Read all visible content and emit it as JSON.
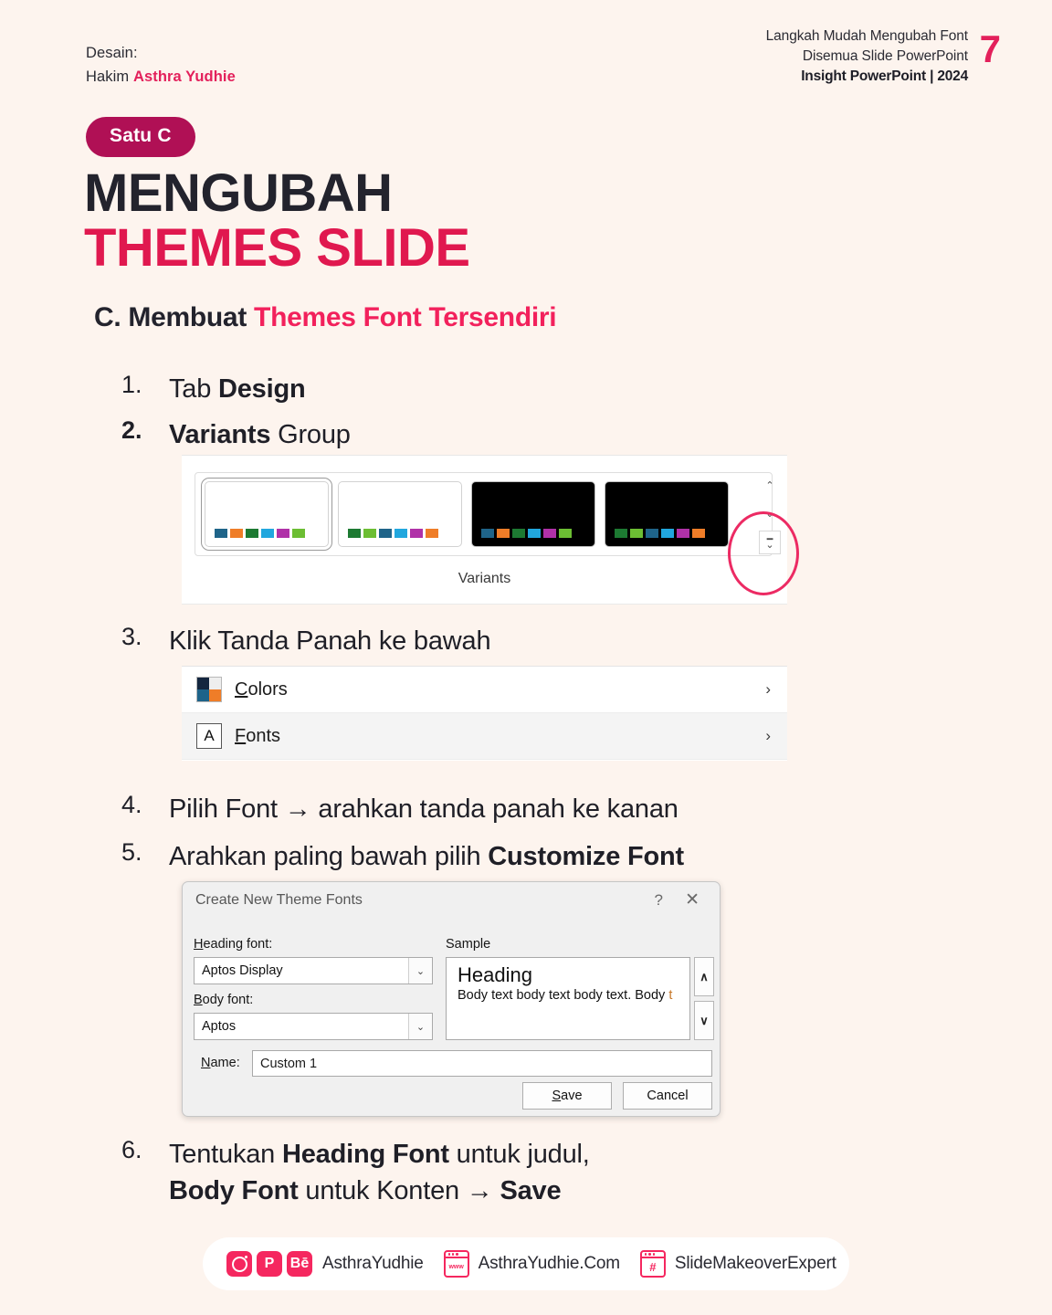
{
  "header": {
    "left_line1": "Desain:",
    "left_line2_plain": "Hakim ",
    "left_line2_bold": "Asthra Yudhie",
    "right_line1": "Langkah Mudah Mengubah Font",
    "right_line2": "Disemua Slide PowerPoint",
    "right_line3": "Insight PowerPoint | 2024",
    "page_number": "7"
  },
  "badge": "Satu C",
  "title": {
    "line1": "MENGUBAH",
    "line2": "THEMES SLIDE"
  },
  "section": {
    "prefix": "C. Membuat ",
    "highlight": "Themes Font Tersendiri"
  },
  "steps": [
    {
      "num": "1.",
      "html": "Tab <b>Design</b>"
    },
    {
      "num": "2.",
      "html": "<b>Variants</b> Group"
    },
    {
      "num": "3.",
      "html": "Klik Tanda Panah ke bawah"
    },
    {
      "num": "4.",
      "html": "Pilih Font → arahkan tanda panah ke kanan"
    },
    {
      "num": "5.",
      "html": "Arahkan paling bawah pilih <b>Customize Font</b>"
    },
    {
      "num": "6.",
      "html": "Tentukan <b>Heading Font</b> untuk judul,<br><b>Body Font</b> untuk Konten → <b>Save</b>"
    }
  ],
  "variants_gallery": {
    "label": "Variants",
    "thumbnails": [
      {
        "background": "#ffffff",
        "selected": true,
        "swatches": [
          "#1f6489",
          "#ef7d28",
          "#1d7a32",
          "#21a7de",
          "#b031a8",
          "#6cbe33"
        ]
      },
      {
        "background": "#ffffff",
        "selected": false,
        "swatches": [
          "#1d7a32",
          "#6cbe33",
          "#1f6489",
          "#21a7de",
          "#b031a8",
          "#ef7d28"
        ]
      },
      {
        "background": "#000000",
        "selected": false,
        "swatches": [
          "#1f6489",
          "#ef7d28",
          "#1d7a32",
          "#21a7de",
          "#b031a8",
          "#6cbe33"
        ]
      },
      {
        "background": "#000000",
        "selected": false,
        "swatches": [
          "#1d7a32",
          "#6cbe33",
          "#1f6489",
          "#21a7de",
          "#b031a8",
          "#ef7d28"
        ]
      }
    ],
    "scroll_up": "⌃",
    "scroll_down": "⌄",
    "scroll_more": "⌄",
    "highlight_color": "#ec2a63"
  },
  "menu": {
    "items": [
      {
        "label_underline": "C",
        "label_rest": "olors",
        "icon": "colors-swatch-icon",
        "chevron": "›",
        "highlighted": false
      },
      {
        "label_underline": "F",
        "label_rest": "onts",
        "icon": "font-a-icon",
        "chevron": "›",
        "highlighted": true
      }
    ],
    "colors_icon_swatches": [
      "#14263f",
      "#eeeeee",
      "#1d6389",
      "#ef7d28"
    ],
    "fonts_icon_glyph": "A"
  },
  "dialog": {
    "title": "Create New Theme Fonts",
    "help_glyph": "?",
    "close_glyph": "✕",
    "heading_font_label_u": "H",
    "heading_font_label_rest": "eading font:",
    "heading_font_value": "Aptos Display",
    "body_font_label_u": "B",
    "body_font_label_rest": "ody font:",
    "body_font_value": "Aptos",
    "sample_label": "Sample",
    "sample_heading": "Heading",
    "sample_body": "Body text body text body text. Body ",
    "sample_body_tail": "t",
    "sample_scroll_up": "∧",
    "sample_scroll_down": "∨",
    "name_label_u": "N",
    "name_label_rest": "ame:",
    "name_value": "Custom 1",
    "save_u": "S",
    "save_rest": "ave",
    "cancel": "Cancel",
    "combo_arrow": "⌄"
  },
  "footer": {
    "handle": "AsthraYudhie",
    "website": "AsthraYudhie.Com",
    "community": "SlideMakeoverExpert",
    "instagram_icon": "instagram-icon",
    "pinterest_glyph": "𝑷",
    "behance_glyph": "Bē",
    "www_glyph": "www",
    "hash_glyph": "#",
    "accent": "#f5275f"
  }
}
